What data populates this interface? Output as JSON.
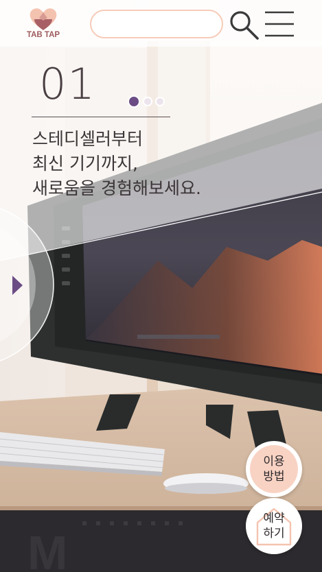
{
  "header": {
    "logo_text": "TAB TAP",
    "search_placeholder": "",
    "search_value": ""
  },
  "slide": {
    "number": "01",
    "headline_lines": [
      "스테디셀러부터",
      "최신 기기까지,",
      "새로움을 경험해보세요."
    ],
    "page_count": 3,
    "active_index": 0
  },
  "buttons": {
    "how_to_use": [
      "이용",
      "방법"
    ],
    "reserve": [
      "예약",
      "하기"
    ]
  },
  "colors": {
    "accent_purple": "#6b4c84",
    "peach": "#f8d3c4",
    "logo_brown": "#9e5b5e"
  },
  "icons": {
    "search": "search-icon",
    "menu": "hamburger-menu-icon",
    "prev": "play-left-arrow-icon"
  }
}
